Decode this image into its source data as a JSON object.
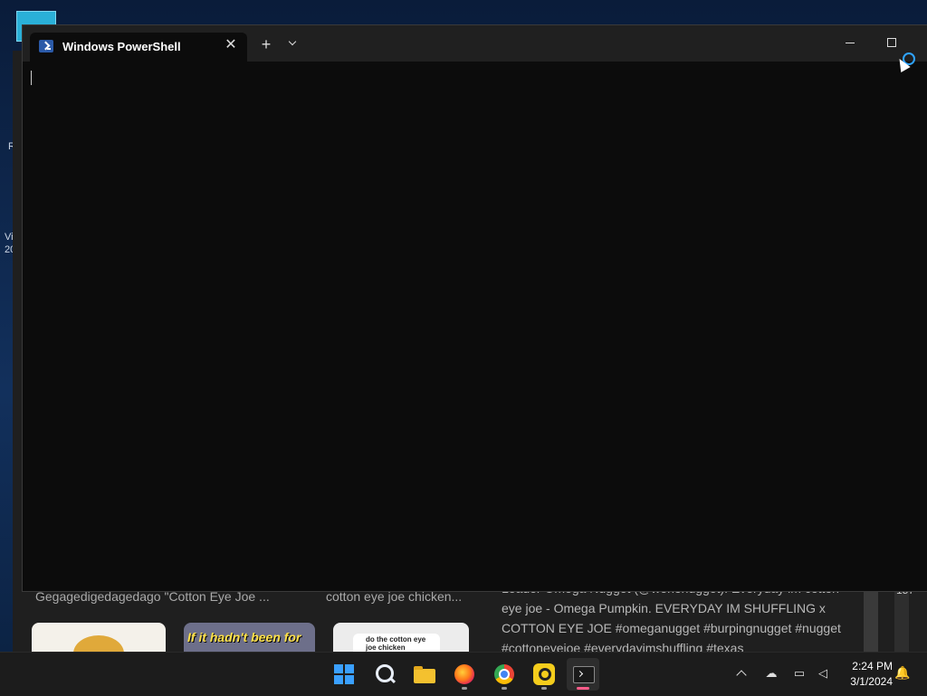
{
  "window": {
    "tab_title": "Windows PowerShell",
    "tab_close_glyph": "✕",
    "new_tab_glyph": "+"
  },
  "background_page": {
    "left_edge_fragments": [
      "R",
      "Vi",
      "20"
    ],
    "right_edge_fragments": [
      "ew",
      "157"
    ],
    "captions": [
      "Gegagedigedagedago \"Cotton Eye Joe ...",
      "cotton eye joe chicken..."
    ],
    "description": "Leader Omega Nugget (@wenonugget). Everyday im cotton eye joe - Omega Pumpkin. EVERYDAY IM SHUFFLING x COTTON EYE JOE #omeganugget #burpingnugget #nugget #cottoneyejoe #everydayimshuffling #texas",
    "thumbnails": {
      "thumb2_text": "If it hadn't been for",
      "thumb3_text": "do the cotton eye joe chicken nugget"
    }
  },
  "taskbar": {
    "apps": [
      "start",
      "search",
      "file-explorer",
      "firefox",
      "chrome",
      "yellow-app",
      "terminal"
    ],
    "tray": {
      "clock_time": "2:24 PM",
      "clock_date": "3/1/2024"
    }
  },
  "colors": {
    "console_bg": "#0c0c0c",
    "titlebar_bg": "#202020",
    "taskbar_bg": "#1c1c1c",
    "accent": "#3aa0ff"
  }
}
